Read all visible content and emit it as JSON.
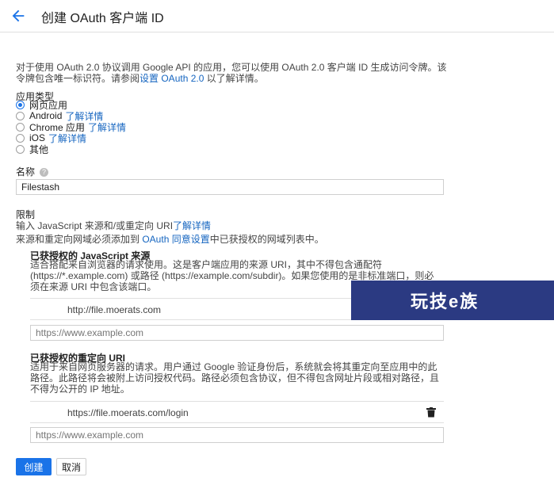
{
  "header": {
    "title": "创建 OAuth 客户端 ID",
    "back_icon": "arrow-back-icon",
    "accent": "#1a73e8"
  },
  "intro": {
    "text_before_link": "对于使用 OAuth 2.0 协议调用 Google API 的应用，您可以使用 OAuth 2.0 客户端 ID 生成访问令牌。该令牌包含唯一标识符。请参阅",
    "link": "设置 OAuth 2.0",
    "text_after_link": " 以了解详情。"
  },
  "app_type": {
    "label": "应用类型",
    "selected": "网页应用",
    "options": [
      {
        "label": "网页应用",
        "link": ""
      },
      {
        "label": "Android",
        "link": "了解详情"
      },
      {
        "label": "Chrome 应用",
        "link": "了解详情"
      },
      {
        "label": "iOS",
        "link": "了解详情"
      },
      {
        "label": "其他",
        "link": ""
      }
    ]
  },
  "name": {
    "label": "名称",
    "help_icon": "help-icon",
    "help_glyph": "?",
    "value": "Filestash"
  },
  "restrictions": {
    "label": "限制",
    "line1_before_link": "输入 JavaScript 来源和/或重定向 URI",
    "line1_link": "了解详情",
    "line2_before_link": "来源和重定向网域必须添加到 ",
    "line2_link": "OAuth 同意设置",
    "line2_after_link": "中已获授权的网域列表中。"
  },
  "js_origins": {
    "title": "已获授权的 JavaScript 来源",
    "description": "适合搭配来自浏览器的请求使用。这是客户端应用的来源 URI，其中不得包含通配符 (https://*.example.com) 或路径 (https://example.com/subdir)。如果您使用的是非标准端口，则必须在来源 URI 中包含该端口。",
    "entries": [
      "http://file.moerats.com"
    ],
    "placeholder": "https://www.example.com"
  },
  "redirect_uris": {
    "title": "已获授权的重定向 URI",
    "description": "适用于来自网页服务器的请求。用户通过 Google 验证身份后，系统就会将其重定向至应用中的此路径。此路径将会被附上访问授权代码。路径必须包含协议，但不得包含网址片段或相对路径，且不得为公开的 IP 地址。",
    "entries": [
      "https://file.moerats.com/login"
    ],
    "placeholder": "https://www.example.com",
    "delete_icon": "trash-icon"
  },
  "watermark": {
    "text": "玩技e族",
    "color": "#2b3a82"
  },
  "actions": {
    "create": "创建",
    "cancel": "取消"
  }
}
